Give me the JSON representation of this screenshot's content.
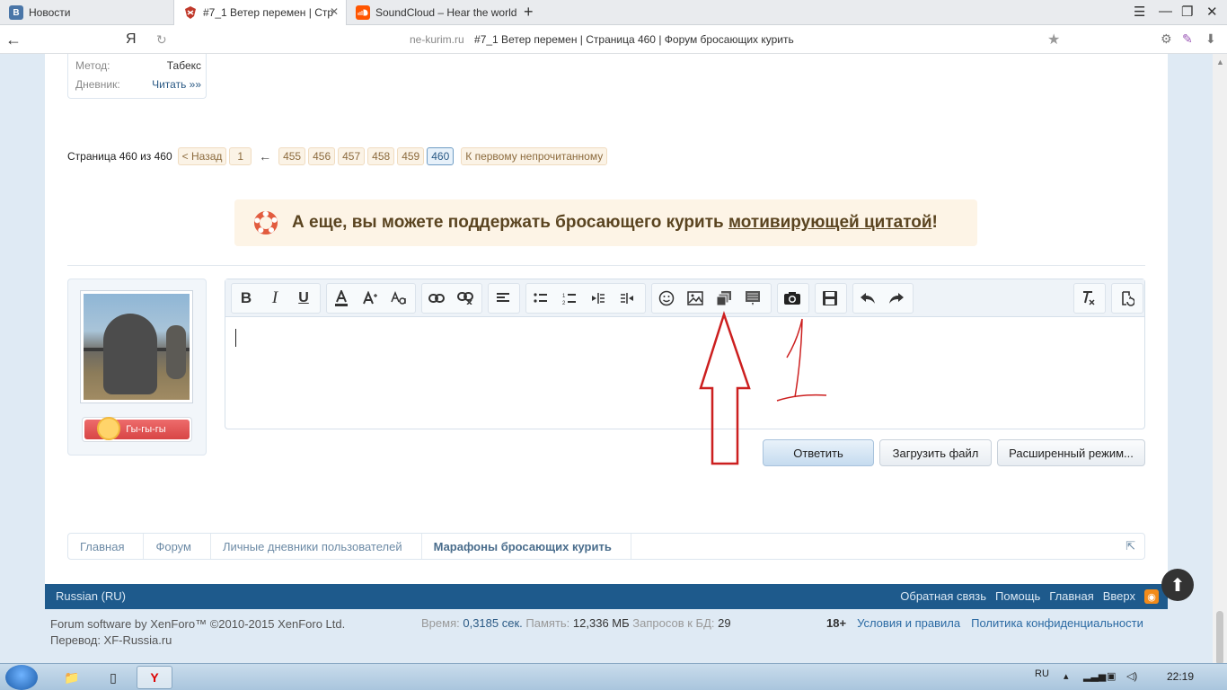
{
  "browser": {
    "tabs": [
      {
        "title": "Новости",
        "icon": "vk-icon",
        "icon_text": "В",
        "color": "#4a76a8"
      },
      {
        "title": "#7_1 Ветер перемен | Стр",
        "icon": "forum-favicon",
        "icon_text": "",
        "color": "#c0392b"
      },
      {
        "title": "SoundCloud – Hear the world",
        "icon": "soundcloud-icon",
        "icon_text": "",
        "color": "#ff5500"
      }
    ],
    "new_tab": "+",
    "yandex_logo": "Я",
    "url_domain": "ne-kurim.ru",
    "url_title": "#7_1 Ветер перемен | Страница 460 | Форум бросающих курить"
  },
  "profile_info": {
    "method_label": "Метод:",
    "method_value": "Табекс",
    "diary_label": "Дневник:",
    "diary_value": "Читать »»"
  },
  "pagination": {
    "label": "Страница 460 из 460",
    "back": "< Назад",
    "first": "1",
    "ellipsis": "←",
    "pages": [
      "455",
      "456",
      "457",
      "458",
      "459"
    ],
    "current": "460",
    "unread": "К первому непрочитанному"
  },
  "banner": {
    "text": "А еще, вы можете поддержать бросающего курить",
    "link": "мотивирующей цитатой",
    "end": "!"
  },
  "user": {
    "badge": "Гы-гы-гы"
  },
  "editor": {
    "buttons": {
      "bold": "B",
      "italic": "I",
      "underline": "U"
    }
  },
  "actions": {
    "reply": "Ответить",
    "upload": "Загрузить файл",
    "advanced": "Расширенный режим..."
  },
  "breadcrumbs": [
    "Главная",
    "Форум",
    "Личные дневники пользователей",
    "Марафоны бросающих курить"
  ],
  "footer": {
    "language": "Russian (RU)",
    "links": [
      "Обратная связь",
      "Помощь",
      "Главная",
      "Вверх"
    ],
    "copyright": "Forum software by XenForo™ ©2010-2015 XenForo Ltd.",
    "translation": "Перевод: XF-Russia.ru",
    "time_label": "Время:",
    "time_value": "0,3185 сек.",
    "memory_label": "Память:",
    "memory_value": "12,336 МБ",
    "queries_label": "Запросов к БД:",
    "queries_value": "29",
    "age": "18+",
    "terms": "Условия и правила",
    "privacy": "Политика конфиденциальности"
  },
  "annotation": {
    "handwritten": "1",
    "arrow_color": "#cc1f1f"
  },
  "taskbar": {
    "lang": "RU",
    "clock": "22:19",
    "yandex": "Y"
  }
}
